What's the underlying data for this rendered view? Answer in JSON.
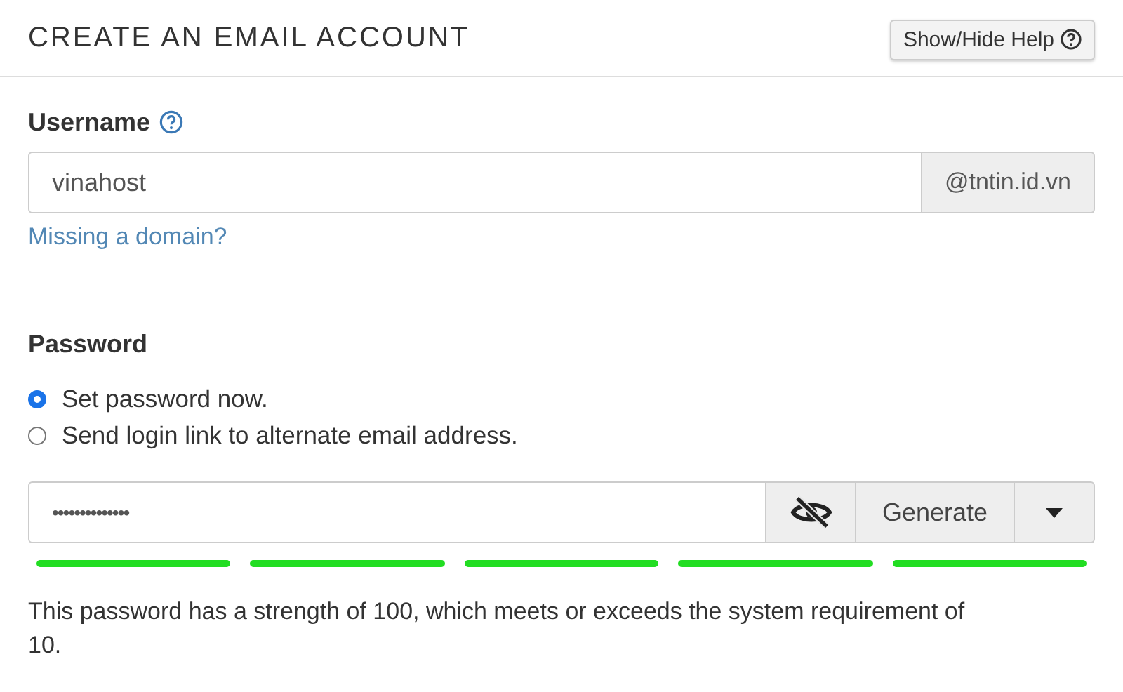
{
  "header": {
    "title": "CREATE AN EMAIL ACCOUNT",
    "help_button": "Show/Hide Help"
  },
  "username": {
    "label": "Username",
    "value": "vinahost",
    "domain": "@tntin.id.vn",
    "link": "Missing a domain?"
  },
  "password": {
    "label": "Password",
    "options": [
      {
        "label": "Set password now.",
        "selected": true
      },
      {
        "label": "Send login link to alternate email address.",
        "selected": false
      }
    ],
    "value": "••••••••••••••",
    "shown": false,
    "generate_button": "Generate",
    "message": "This password has a strength of 100, which meets or exceeds the system requirement of 10."
  }
}
